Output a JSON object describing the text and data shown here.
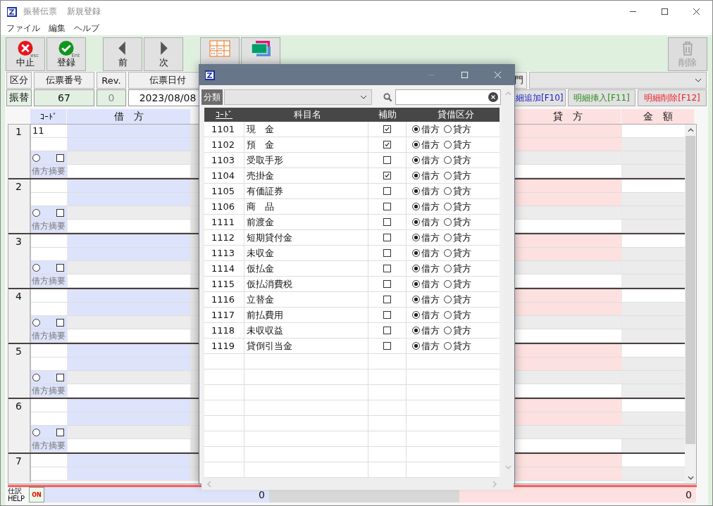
{
  "window": {
    "title": "振替伝票",
    "mode": "新規登録"
  },
  "menu": [
    "ファイル",
    "編集",
    "ヘルプ"
  ],
  "toolbar": [
    {
      "kind": "cancel",
      "label": "中止",
      "hint": "esc"
    },
    {
      "kind": "save",
      "label": "登録",
      "hint": "Ent"
    },
    {
      "kind": "prev",
      "label": "前"
    },
    {
      "kind": "next",
      "label": "次"
    },
    {
      "kind": "ledger"
    },
    {
      "kind": "pattern"
    },
    {
      "kind": "delete",
      "label": "削除",
      "disabled": true
    }
  ],
  "header": {
    "labels": [
      "区分",
      "伝票番号",
      "Rev.",
      "伝票日付"
    ],
    "values": [
      "振替",
      "67",
      "0",
      "2023/08/08"
    ],
    "dept_label": "門"
  },
  "line_buttons": [
    {
      "label": "細追加[F10]",
      "color": "#1a1acc"
    },
    {
      "label": "明細挿入[F11]",
      "color": "#2a8a1a"
    },
    {
      "label": "明細削除[F12]",
      "color": "#ee1c24"
    }
  ],
  "columns": {
    "code": "ｺｰﾄﾞ",
    "debit": "借　方",
    "credit": "貸　方",
    "amount": "金　額"
  },
  "entries": [
    {
      "no": "1",
      "code": "11",
      "radio_selected": false,
      "checked": false,
      "memo_label": "借方摘要"
    },
    {
      "no": "2",
      "radio_selected": false,
      "checked": false,
      "memo_label": "借方摘要"
    },
    {
      "no": "3",
      "radio_selected": false,
      "checked": false,
      "memo_label": "借方摘要"
    },
    {
      "no": "4",
      "radio_selected": false,
      "checked": false,
      "memo_label": "借方摘要"
    },
    {
      "no": "5",
      "radio_selected": false,
      "checked": false,
      "memo_label": "借方摘要"
    },
    {
      "no": "6",
      "radio_selected": false,
      "checked": false,
      "memo_label": "借方摘要"
    },
    {
      "no": "7"
    }
  ],
  "totals": {
    "help_top": "仕訳",
    "help_bottom": "HELP",
    "help_on": "ON",
    "debit": "0",
    "credit": "0"
  },
  "dialog": {
    "filter_label": "分類",
    "columns": [
      "ｺｰﾄﾞ",
      "科目名",
      "補助",
      "貸借区分"
    ],
    "rows": [
      {
        "code": "1101",
        "name": "現　金",
        "aux": true,
        "options": [
          {
            "label": "借方",
            "selected": true
          },
          {
            "label": "貸方",
            "selected": false
          }
        ]
      },
      {
        "code": "1102",
        "name": "預　金",
        "aux": true,
        "options": [
          {
            "label": "借方",
            "selected": true
          },
          {
            "label": "貸方",
            "selected": false
          }
        ]
      },
      {
        "code": "1103",
        "name": "受取手形",
        "aux": false,
        "options": [
          {
            "label": "借方",
            "selected": true
          },
          {
            "label": "貸方",
            "selected": false
          }
        ]
      },
      {
        "code": "1104",
        "name": "売掛金",
        "aux": true,
        "options": [
          {
            "label": "借方",
            "selected": true
          },
          {
            "label": "貸方",
            "selected": false
          }
        ]
      },
      {
        "code": "1105",
        "name": "有価証券",
        "aux": false,
        "options": [
          {
            "label": "借方",
            "selected": true
          },
          {
            "label": "貸方",
            "selected": false
          }
        ]
      },
      {
        "code": "1106",
        "name": "商　品",
        "aux": false,
        "options": [
          {
            "label": "借方",
            "selected": true
          },
          {
            "label": "貸方",
            "selected": false
          }
        ]
      },
      {
        "code": "1111",
        "name": "前渡金",
        "aux": false,
        "options": [
          {
            "label": "借方",
            "selected": true
          },
          {
            "label": "貸方",
            "selected": false
          }
        ]
      },
      {
        "code": "1112",
        "name": "短期貸付金",
        "aux": false,
        "options": [
          {
            "label": "借方",
            "selected": true
          },
          {
            "label": "貸方",
            "selected": false
          }
        ]
      },
      {
        "code": "1113",
        "name": "未収金",
        "aux": false,
        "options": [
          {
            "label": "借方",
            "selected": true
          },
          {
            "label": "貸方",
            "selected": false
          }
        ]
      },
      {
        "code": "1114",
        "name": "仮払金",
        "aux": false,
        "options": [
          {
            "label": "借方",
            "selected": true
          },
          {
            "label": "貸方",
            "selected": false
          }
        ]
      },
      {
        "code": "1115",
        "name": "仮払消費税",
        "aux": false,
        "options": [
          {
            "label": "借方",
            "selected": true
          },
          {
            "label": "貸方",
            "selected": false
          }
        ]
      },
      {
        "code": "1116",
        "name": "立替金",
        "aux": false,
        "options": [
          {
            "label": "借方",
            "selected": true
          },
          {
            "label": "貸方",
            "selected": false
          }
        ]
      },
      {
        "code": "1117",
        "name": "前払費用",
        "aux": false,
        "options": [
          {
            "label": "借方",
            "selected": true
          },
          {
            "label": "貸方",
            "selected": false
          }
        ]
      },
      {
        "code": "1118",
        "name": "未収収益",
        "aux": false,
        "options": [
          {
            "label": "借方",
            "selected": true
          },
          {
            "label": "貸方",
            "selected": false
          }
        ]
      },
      {
        "code": "1119",
        "name": "貸倒引当金",
        "aux": false,
        "options": [
          {
            "label": "借方",
            "selected": true
          },
          {
            "label": "貸方",
            "selected": false
          }
        ]
      }
    ]
  }
}
